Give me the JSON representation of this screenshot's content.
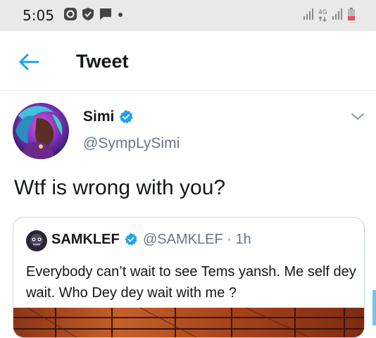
{
  "status_bar": {
    "time": "5:05",
    "network": "4G",
    "icons_left": [
      "circle-app-icon",
      "shield-icon",
      "chat-icon",
      "dot-icon"
    ],
    "icons_right": [
      "signal-icon",
      "network-4g-icon",
      "signal-icon",
      "battery-icon"
    ]
  },
  "header": {
    "title": "Tweet",
    "back_icon": "arrow-left-icon"
  },
  "tweet": {
    "author_name": "Simi",
    "author_handle": "@SympLySimi",
    "text": "Wtf is wrong with you?",
    "quoted": {
      "author_name": "SAMKLEF",
      "author_handle": "@SAMKLEF",
      "age": "· 1h",
      "text": "Everybody can’t wait to see Tems yansh. Me self dey wait. Who Dey dey wait with me ?"
    }
  },
  "colors": {
    "accent": "#1da1f2",
    "text_primary": "#14171a",
    "text_secondary": "#657786",
    "border": "#ccd6dd",
    "status_bar_bg": "#e9e9e9"
  }
}
